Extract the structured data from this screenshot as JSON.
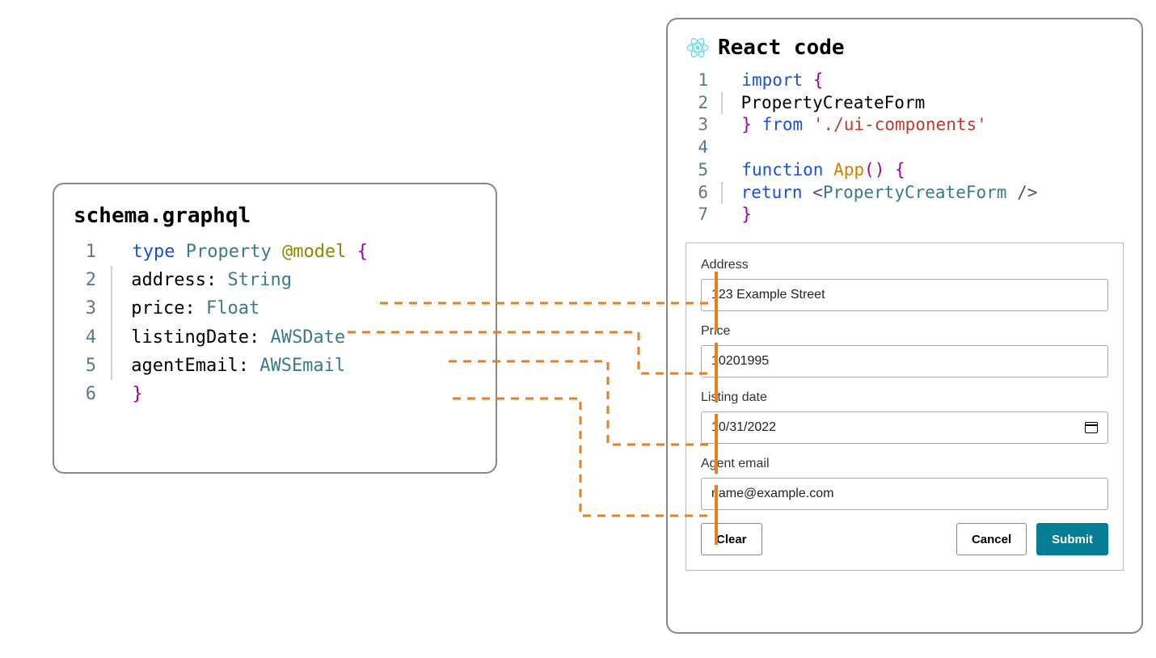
{
  "schema": {
    "title": "schema.graphql",
    "lines": {
      "l1_type": "type",
      "l1_name": "Property",
      "l1_anno": "@model",
      "l1_brace": "{",
      "l2_field": "address",
      "l2_type": "String",
      "l3_field": "price",
      "l3_type": "Float",
      "l4_field": "listingDate",
      "l4_type": "AWSDate",
      "l5_field": "agentEmail",
      "l5_type": "AWSEmail",
      "l6_brace": "}",
      "n1": "1",
      "n2": "2",
      "n3": "3",
      "n4": "4",
      "n5": "5",
      "n6": "6"
    }
  },
  "react": {
    "title": "React code",
    "lines": {
      "l1_import": "import",
      "l1_brace": "{",
      "l2_name": "PropertyCreateForm",
      "l3_brace": "}",
      "l3_from": "from",
      "l3_path": "'./ui-components'",
      "l5_function": "function",
      "l5_app": "App",
      "l5_parens": "()",
      "l5_brace": "{",
      "l6_return": "return",
      "l6_lt": "<",
      "l6_comp": "PropertyCreateForm",
      "l6_close": "/>",
      "l7_brace": "}",
      "n1": "1",
      "n2": "2",
      "n3": "3",
      "n4": "4",
      "n5": "5",
      "n6": "6",
      "n7": "7"
    }
  },
  "form": {
    "address_label": "Address",
    "address_value": "123 Example Street",
    "price_label": "Price",
    "price_value": "10201995",
    "date_label": "Listing date",
    "date_value": "10/31/2022",
    "email_label": "Agent email",
    "email_value": "name@example.com",
    "clear": "Clear",
    "cancel": "Cancel",
    "submit": "Submit"
  },
  "colors": {
    "connector": "#e67e22",
    "marker": "#e67e22",
    "react_icon": "#61dafb"
  }
}
